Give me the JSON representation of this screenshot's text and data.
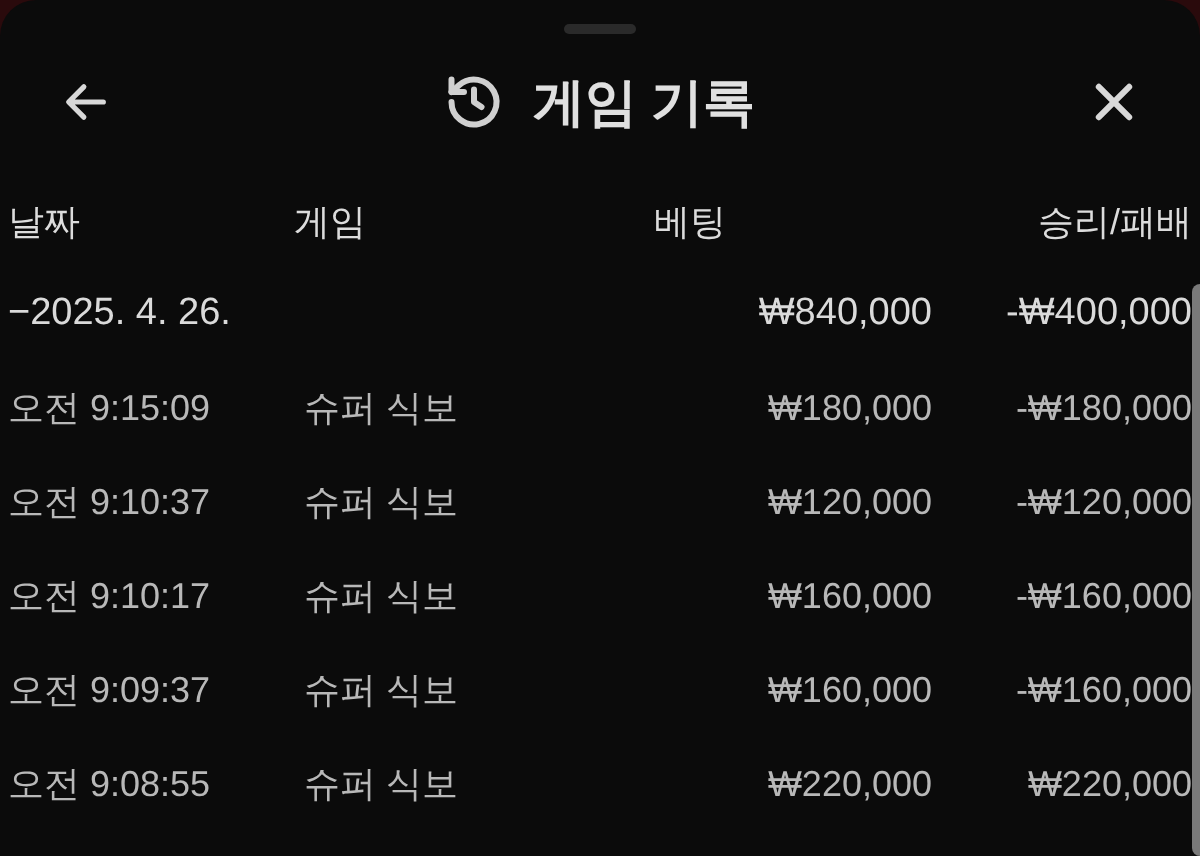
{
  "header": {
    "title": "게임 기록"
  },
  "table": {
    "columns": [
      "날짜",
      "게임",
      "베팅",
      "승리/패배"
    ],
    "group": {
      "date": "−2025. 4. 26.",
      "bet": "₩840,000",
      "result": "-₩400,000"
    },
    "rows": [
      {
        "time": "오전 9:15:09",
        "game": "슈퍼 식보",
        "bet": "₩180,000",
        "result": "-₩180,000"
      },
      {
        "time": "오전 9:10:37",
        "game": "슈퍼 식보",
        "bet": "₩120,000",
        "result": "-₩120,000"
      },
      {
        "time": "오전 9:10:17",
        "game": "슈퍼 식보",
        "bet": "₩160,000",
        "result": "-₩160,000"
      },
      {
        "time": "오전 9:09:37",
        "game": "슈퍼 식보",
        "bet": "₩160,000",
        "result": "-₩160,000"
      },
      {
        "time": "오전 9:08:55",
        "game": "슈퍼 식보",
        "bet": "₩220,000",
        "result": "₩220,000"
      }
    ]
  }
}
